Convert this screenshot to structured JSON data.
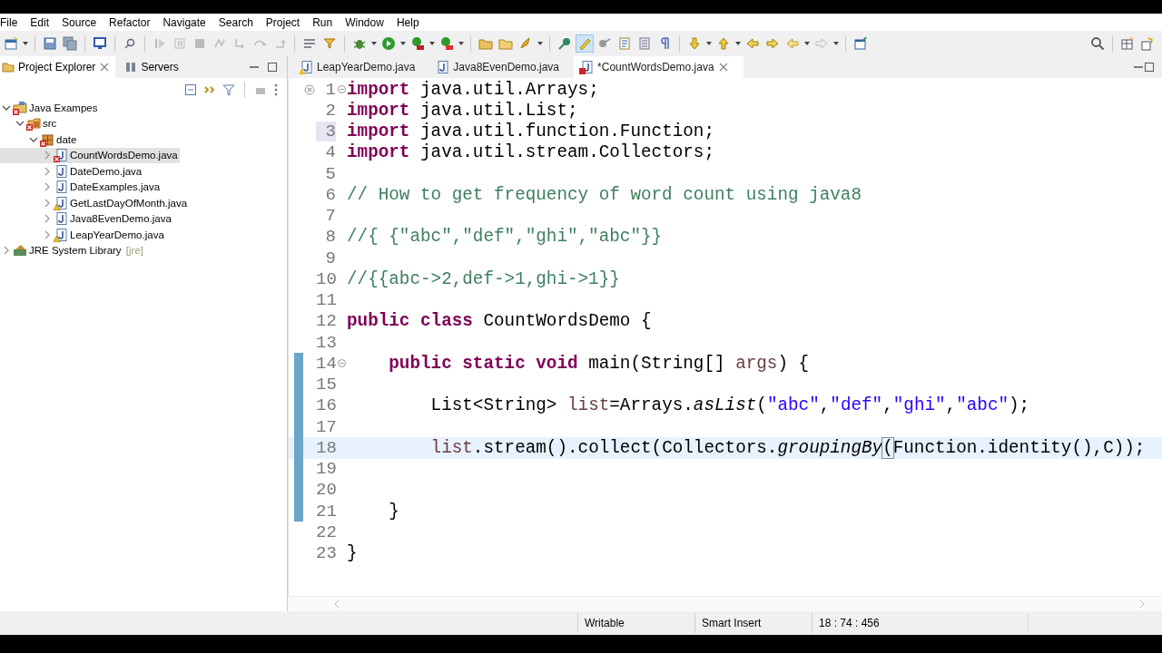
{
  "menu_bar": [
    "File",
    "Edit",
    "Source",
    "Refactor",
    "Navigate",
    "Search",
    "Project",
    "Run",
    "Window",
    "Help"
  ],
  "side_panel": {
    "tabs": [
      {
        "label": "Project Explorer",
        "selected": true
      },
      {
        "label": "Servers",
        "selected": false
      }
    ],
    "tree": [
      {
        "label": "Java Exampes",
        "kind": "project",
        "error": true,
        "warning": false,
        "expanded": true,
        "selected": false,
        "children": [
          {
            "label": "src",
            "kind": "source-folder",
            "error": true,
            "warning": false,
            "expanded": true,
            "selected": false,
            "children": [
              {
                "label": "date",
                "kind": "package",
                "error": true,
                "warning": false,
                "expanded": true,
                "selected": false,
                "children": [
                  {
                    "label": "CountWordsDemo.java",
                    "kind": "file",
                    "error": true,
                    "warning": false,
                    "expanded": false,
                    "selected": true
                  },
                  {
                    "label": "DateDemo.java",
                    "kind": "file",
                    "error": false,
                    "warning": false,
                    "expanded": false,
                    "selected": false
                  },
                  {
                    "label": "DateExamples.java",
                    "kind": "file",
                    "error": false,
                    "warning": false,
                    "expanded": false,
                    "selected": false
                  },
                  {
                    "label": "GetLastDayOfMonth.java",
                    "kind": "file",
                    "error": false,
                    "warning": true,
                    "expanded": false,
                    "selected": false
                  },
                  {
                    "label": "Java8EvenDemo.java",
                    "kind": "file",
                    "error": false,
                    "warning": false,
                    "expanded": false,
                    "selected": false
                  },
                  {
                    "label": "LeapYearDemo.java",
                    "kind": "file",
                    "error": false,
                    "warning": true,
                    "expanded": false,
                    "selected": false
                  }
                ]
              }
            ]
          }
        ]
      },
      {
        "label": "JRE System Library",
        "decoration": "[jre]",
        "kind": "library",
        "error": false,
        "warning": false,
        "expanded": false,
        "selected": false
      }
    ]
  },
  "editor": {
    "tabs": [
      {
        "label": "LeapYearDemo.java",
        "selected": false,
        "error": false,
        "warning": true
      },
      {
        "label": "Java8EvenDemo.java",
        "selected": false,
        "error": false,
        "warning": false
      },
      {
        "label": "*CountWordsDemo.java",
        "selected": true,
        "error": true,
        "warning": false
      }
    ],
    "lines": [
      {
        "number": "1",
        "error": true,
        "fold": true,
        "changed": false,
        "current": false,
        "marked": false,
        "tokens": [
          {
            "kind": "keyword",
            "text": "import"
          },
          {
            "kind": "plain",
            "text": " java.util.Arrays;"
          }
        ]
      },
      {
        "number": "2",
        "error": false,
        "fold": false,
        "changed": false,
        "current": false,
        "marked": false,
        "tokens": [
          {
            "kind": "keyword",
            "text": "import"
          },
          {
            "kind": "plain",
            "text": " java.util.List;"
          }
        ]
      },
      {
        "number": "3",
        "error": false,
        "fold": false,
        "changed": false,
        "current": false,
        "marked": true,
        "tokens": [
          {
            "kind": "keyword",
            "text": "import"
          },
          {
            "kind": "plain",
            "text": " java.util.function.Function;"
          }
        ]
      },
      {
        "number": "4",
        "error": false,
        "fold": false,
        "changed": false,
        "current": false,
        "marked": false,
        "tokens": [
          {
            "kind": "keyword",
            "text": "import"
          },
          {
            "kind": "plain",
            "text": " java.util.stream.Collectors;"
          }
        ]
      },
      {
        "number": "5",
        "error": false,
        "fold": false,
        "changed": false,
        "current": false,
        "marked": false
      },
      {
        "number": "6",
        "error": false,
        "fold": false,
        "changed": false,
        "current": false,
        "marked": false,
        "tokens": [
          {
            "kind": "comment",
            "text": "// How to get frequency of word count using java8"
          }
        ]
      },
      {
        "number": "7",
        "error": false,
        "fold": false,
        "changed": false,
        "current": false,
        "marked": false
      },
      {
        "number": "8",
        "error": false,
        "fold": false,
        "changed": false,
        "current": false,
        "marked": false,
        "tokens": [
          {
            "kind": "comment",
            "text": "//{ {\"abc\",\"def\",\"ghi\",\"abc\"}}"
          }
        ]
      },
      {
        "number": "9",
        "error": false,
        "fold": false,
        "changed": false,
        "current": false,
        "marked": false
      },
      {
        "number": "10",
        "error": false,
        "fold": false,
        "changed": false,
        "current": false,
        "marked": false,
        "tokens": [
          {
            "kind": "comment",
            "text": "//{{abc->2,def->1,ghi->1}}"
          }
        ]
      },
      {
        "number": "11",
        "error": false,
        "fold": false,
        "changed": false,
        "current": false,
        "marked": false
      },
      {
        "number": "12",
        "error": false,
        "fold": false,
        "changed": false,
        "current": false,
        "marked": false,
        "tokens": [
          {
            "kind": "keyword",
            "text": "public class"
          },
          {
            "kind": "plain",
            "text": " CountWordsDemo {"
          }
        ]
      },
      {
        "number": "13",
        "error": false,
        "fold": false,
        "changed": false,
        "current": false,
        "marked": false
      },
      {
        "number": "14",
        "error": false,
        "fold": true,
        "changed": true,
        "current": false,
        "marked": false,
        "tokens": [
          {
            "kind": "keyword",
            "text": "    public static void"
          },
          {
            "kind": "plain",
            "text": " main(String[] "
          },
          {
            "kind": "param",
            "text": "args"
          },
          {
            "kind": "plain",
            "text": ") {"
          }
        ]
      },
      {
        "number": "15",
        "error": false,
        "fold": false,
        "changed": true,
        "current": false,
        "marked": false
      },
      {
        "number": "16",
        "error": false,
        "fold": false,
        "changed": true,
        "current": false,
        "marked": false,
        "tokens": [
          {
            "kind": "plain",
            "text": "        List<String> "
          },
          {
            "kind": "param",
            "text": "list"
          },
          {
            "kind": "plain",
            "text": "=Arrays."
          },
          {
            "kind": "static",
            "text": "asList"
          },
          {
            "kind": "plain",
            "text": "("
          },
          {
            "kind": "string",
            "text": "\"abc\""
          },
          {
            "kind": "plain",
            "text": ","
          },
          {
            "kind": "string",
            "text": "\"def\""
          },
          {
            "kind": "plain",
            "text": ","
          },
          {
            "kind": "string",
            "text": "\"ghi\""
          },
          {
            "kind": "plain",
            "text": ","
          },
          {
            "kind": "string",
            "text": "\"abc\""
          },
          {
            "kind": "plain",
            "text": ");"
          }
        ]
      },
      {
        "number": "17",
        "error": false,
        "fold": false,
        "changed": true,
        "current": false,
        "marked": false
      },
      {
        "number": "18",
        "error": false,
        "fold": false,
        "changed": true,
        "current": true,
        "marked": false,
        "tokens": [
          {
            "kind": "param",
            "text": "        list"
          },
          {
            "kind": "plain",
            "text": ".stream().collect(Collectors."
          },
          {
            "kind": "static",
            "text": "groupingBy"
          },
          {
            "kind": "bracket",
            "text": "("
          },
          {
            "kind": "plain",
            "text": "Function."
          },
          {
            "kind": "static-plain",
            "text": "identity"
          },
          {
            "kind": "plain",
            "text": "(),C));"
          }
        ]
      },
      {
        "number": "19",
        "error": false,
        "fold": false,
        "changed": true,
        "current": false,
        "marked": false
      },
      {
        "number": "20",
        "error": false,
        "fold": false,
        "changed": true,
        "current": false,
        "marked": false
      },
      {
        "number": "21",
        "error": false,
        "fold": false,
        "changed": true,
        "current": false,
        "marked": false,
        "tokens": [
          {
            "kind": "plain",
            "text": "    }"
          }
        ]
      },
      {
        "number": "22",
        "error": false,
        "fold": false,
        "changed": false,
        "current": false,
        "marked": false
      },
      {
        "number": "23",
        "error": false,
        "fold": false,
        "changed": false,
        "current": false,
        "marked": false,
        "tokens": [
          {
            "kind": "plain",
            "text": "}"
          }
        ]
      }
    ]
  },
  "status_bar": {
    "fields": [
      "Writable",
      "Smart Insert",
      "18 : 74 : 456"
    ]
  }
}
